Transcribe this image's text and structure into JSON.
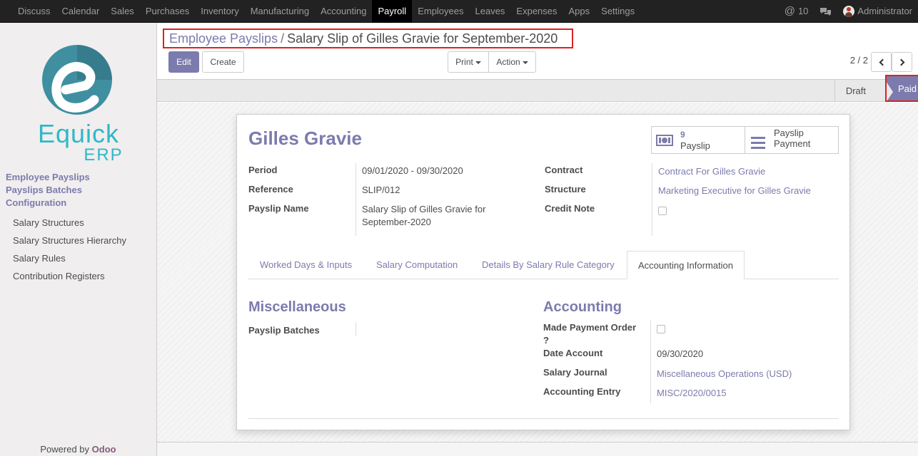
{
  "topbar": {
    "menu": [
      "Discuss",
      "Calendar",
      "Sales",
      "Purchases",
      "Inventory",
      "Manufacturing",
      "Accounting",
      "Payroll",
      "Employees",
      "Leaves",
      "Expenses",
      "Apps",
      "Settings"
    ],
    "active": "Payroll",
    "mentions": "10",
    "user": "Administrator"
  },
  "sidebar": {
    "logo_text_main": "Equick",
    "logo_text_sub": "ERP",
    "headings": [
      "Employee Payslips",
      "Payslips Batches",
      "Configuration"
    ],
    "items": [
      "Salary Structures",
      "Salary Structures Hierarchy",
      "Salary Rules",
      "Contribution Registers"
    ],
    "powered_prefix": "Powered by",
    "powered_brand": "Odoo"
  },
  "control_panel": {
    "breadcrumb_parent": "Employee Payslips",
    "breadcrumb_sep": "/",
    "breadcrumb_current": "Salary Slip of Gilles Gravie for September-2020",
    "edit_label": "Edit",
    "create_label": "Create",
    "print_label": "Print",
    "action_label": "Action",
    "pager": "2 / 2"
  },
  "statusbar": {
    "stages": [
      "Draft",
      "Paid"
    ],
    "current": "Paid"
  },
  "form": {
    "employee": "Gilles Gravie",
    "smart_payslip_count": "9",
    "smart_payslip_label": "Payslip",
    "smart_payment_label_1": "Payslip",
    "smart_payment_label_2": "Payment",
    "left_fields": {
      "period_label": "Period",
      "period_value": "09/01/2020 - 09/30/2020",
      "reference_label": "Reference",
      "reference_value": "SLIP/012",
      "name_label": "Payslip Name",
      "name_value_line1": "Salary Slip of Gilles Gravie for",
      "name_value_line2": "September-2020"
    },
    "right_fields": {
      "contract_label": "Contract",
      "contract_value": "Contract For Gilles Gravie",
      "structure_label": "Structure",
      "structure_value": "Marketing Executive for Gilles Gravie",
      "credit_label": "Credit Note",
      "credit_checked": false
    },
    "tabs": [
      "Worked Days & Inputs",
      "Salary Computation",
      "Details By Salary Rule Category",
      "Accounting Information"
    ],
    "active_tab": "Accounting Information",
    "misc": {
      "title": "Miscellaneous",
      "batches_label": "Payslip Batches",
      "batches_value": ""
    },
    "accounting": {
      "title": "Accounting",
      "made_payment_label_1": "Made Payment Order",
      "made_payment_label_2": "?",
      "made_payment_checked": false,
      "date_label": "Date Account",
      "date_value": "09/30/2020",
      "journal_label": "Salary Journal",
      "journal_value": "Miscellaneous Operations (USD)",
      "entry_label": "Accounting Entry",
      "entry_value": "MISC/2020/0015"
    }
  },
  "colors": {
    "accent": "#7c7bad",
    "highlight": "#e02020",
    "navbar": "#222222"
  }
}
